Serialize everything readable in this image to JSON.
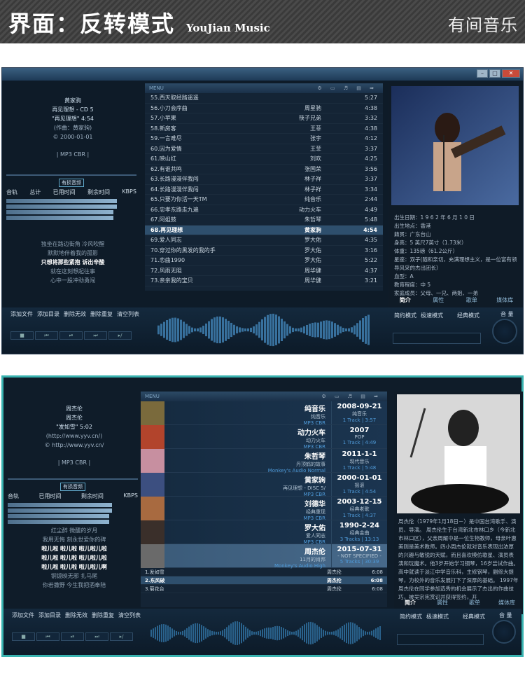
{
  "banner": {
    "title": "界面：反转模式",
    "subtitle": "YouJian Music",
    "brand": "有间音乐"
  },
  "window1": {
    "meta": {
      "artist": "黄家驹",
      "album": "再见理想 - CD 5",
      "track": "\"再见理想\" 4:54",
      "lyricist": "(作曲：黄家驹)",
      "copyright": "© 2000-01-01",
      "format": "| MP3 CBR |"
    },
    "vis": {
      "tabs": [
        "有损音频"
      ],
      "labels": [
        "音轨",
        "总计",
        "已用时间",
        "剩余时间",
        "KBPS"
      ],
      "bitrate": "128"
    },
    "lyrics": [
      "独坐在路边街角 冷风吹醒",
      "默默地伴着我的孤影",
      "只想将那些紧抱 诉出辛酸",
      "就在这刻想起往事",
      "",
      "心中一股冲劲勇闯"
    ],
    "list_label": "MENU",
    "list_icons": "⚙ ▭ ♬ ▤ ➡",
    "rows": [
      {
        "t": "55.西天取经路遥遥",
        "a": "",
        "d": "5:27"
      },
      {
        "t": "56.小刀会序曲",
        "a": "周星驰",
        "d": "4:38"
      },
      {
        "t": "57.小苹果",
        "a": "筷子兄弟",
        "d": "3:32"
      },
      {
        "t": "58.新房客",
        "a": "王菲",
        "d": "4:38"
      },
      {
        "t": "59.一言难尽",
        "a": "张宇",
        "d": "4:12"
      },
      {
        "t": "60.因为爱情",
        "a": "王菲",
        "d": "3:37"
      },
      {
        "t": "61.映山红",
        "a": "刘欢",
        "d": "4:25"
      },
      {
        "t": "62.有谁共鸣",
        "a": "张国荣",
        "d": "3:56"
      },
      {
        "t": "63.长路漫漫伴我闯",
        "a": "林子祥",
        "d": "3:37"
      },
      {
        "t": "64.长路漫漫伴我闯",
        "a": "林子祥",
        "d": "3:34"
      },
      {
        "t": "65.只要为你活一天TM",
        "a": "纯音乐",
        "d": "2:44"
      },
      {
        "t": "66.忠孝东路走九遍",
        "a": "动力火车",
        "d": "4:49"
      },
      {
        "t": "67.阿姐鼓",
        "a": "朱哲琴",
        "d": "5:48"
      },
      {
        "t": "68.再见理想",
        "a": "黄家驹",
        "d": "4:54",
        "sel": true
      },
      {
        "t": "69.爱人同志",
        "a": "罗大佑",
        "d": "4:35"
      },
      {
        "t": "70.穿过你的黑发的我的手",
        "a": "罗大佑",
        "d": "3:16"
      },
      {
        "t": "71.恋曲1990",
        "a": "罗大佑",
        "d": "5:22"
      },
      {
        "t": "72.风雨无阻",
        "a": "周华健",
        "d": "4:37"
      },
      {
        "t": "73.亲亲我的宝贝",
        "a": "周华健",
        "d": "3:21"
      }
    ],
    "bio": [
      "出生日期：1 9 6 2 年 6 月 1 0 日",
      "出生地点：香港",
      "籍贯：广东台山",
      "身高：5 英尺7英寸（1.73米）",
      "体重：135磅（61.2公斤）",
      "星座：双子(随和亲切，充满理想主义，是一位富有领导风采的杰出团长）",
      "血型：A",
      "教育程度：中 5",
      "家庭成员：父母、一兄、两姐、一弟"
    ],
    "right_tabs": [
      "简介",
      "属性",
      "歌单",
      "媒体库"
    ],
    "bottom_btns": [
      "添加文件",
      "添加目录",
      "删除无效",
      "删除重复",
      "清空列表"
    ],
    "ctrl_icons": [
      "■",
      "⏮",
      "⏯",
      "⏭",
      "▸/"
    ],
    "mode_btns": [
      "简约模式",
      "极速模式",
      "经典模式"
    ],
    "volume": "音 量"
  },
  "window2": {
    "meta": {
      "artist": "周杰伦",
      "album": "周杰伦",
      "track": "\"发如雪\" 5:02",
      "url1": "(http://www.yyv.cn/)",
      "url2": "© http://www.yyv.cn/",
      "format": "| MP3 CBR |"
    },
    "vis": {
      "tabs": [
        "有损音频"
      ],
      "labels": [
        "音轨",
        "已用时间",
        "剩余时间",
        "KBPS"
      ],
      "bitrate": "320"
    },
    "lyrics": [
      "红尘醉 微醺的岁月",
      "我用无悔 刻永世爱你的碑",
      "",
      "啦儿啦 啦儿啦 啦儿啦儿啦",
      "啦儿啦 啦儿啦 啦儿啦儿啦",
      "啦儿啦 啦儿啦 啦儿啦儿啊",
      "铜镜映无邪 扎马尾",
      "你若撒野 今生我把酒奉陪"
    ],
    "list_label": "MENU",
    "list_icons": "⚙ ▭ ♬ ▤ ➡",
    "albums": [
      {
        "a": "纯音乐",
        "b": "纯音乐",
        "c": "MP3 CBR",
        "d": "2008-09-21",
        "e": "纯音乐",
        "f": "1 Track | 3:57",
        "color": "#7a6a3c"
      },
      {
        "a": "动力火车",
        "b": "动力火车",
        "c": "MP3 CBR",
        "d": "2007",
        "e": "POP",
        "f": "1 Track | 4:49",
        "color": "#b2442c"
      },
      {
        "a": "朱哲琴",
        "b": "丹顶鹤的故事",
        "c": "Monkey's Audio Normal",
        "d": "2011-1-1",
        "e": "现代音乐",
        "f": "1 Track | 5:48",
        "color": "#c78fa0"
      },
      {
        "a": "黄家驹",
        "b": "再见理想 - DISC 5/",
        "c": "MP3 CBR",
        "d": "2000-01-01",
        "e": "摇滚",
        "f": "1 Track | 4:54",
        "color": "#3c4f80"
      },
      {
        "a": "刘德华",
        "b": "经典重现",
        "c": "MP3 CBR",
        "d": "2003-12-15",
        "e": "经典老歌",
        "f": "1 Track | 4:37",
        "color": "#a86a40"
      },
      {
        "a": "罗大佑",
        "b": "爱人同志",
        "c": "MP3 CBR",
        "d": "1990-2-24",
        "e": "经典金曲",
        "f": "3 Tracks | 13:13",
        "color": "#3a2f2a"
      },
      {
        "a": "周杰伦",
        "b": "11月的肖邦",
        "c": "Monkey's Audio High",
        "d": "2015-07-31",
        "e": "- NOT SPECIFIED -",
        "f": "5 Tracks | 30:39",
        "color": "#6a6a6a",
        "sel": true
      }
    ],
    "tracks": [
      {
        "t": "1.发如雪",
        "a": "周杰伦",
        "d": "6:08"
      },
      {
        "t": "2.东风破",
        "a": "周杰伦",
        "d": "6:08",
        "sel": true
      },
      {
        "t": "3.菊花台",
        "a": "周杰伦",
        "d": "6:08"
      }
    ],
    "bio": "周杰伦（1979年1月18日－）是中国台湾歌手、演员、导演。 周杰伦生于台湾新北市林口乡（今新北市林口区），父亲周耀中是一位生物教师，母亲叶惠美则是美术教师。四小周杰伦就对音乐表现出浓厚的兴趣与敏锐的天赋，而且喜欢模仿歌星、演员表演和玩魔术。他3岁开始学习钢琴，16岁尝试作曲。高中就读于淡江中学音乐科，主修钢琴，副修大提琴，为校外的音乐发展打下了深厚的基础。 1997年周杰伦在同学参加选秀的机会展示了杰出的作曲技巧，被吴宗宪赏识并获得签约，开",
    "right_tabs": [
      "简介",
      "属性",
      "歌单",
      "媒体库"
    ],
    "bottom_btns": [
      "添加文件",
      "添加目录",
      "删除无效",
      "删除重复",
      "清空列表"
    ],
    "ctrl_icons": [
      "■",
      "⏮",
      "⏯",
      "⏭",
      "▸/"
    ],
    "mode_btns": [
      "简约模式",
      "极速模式",
      "经典模式"
    ],
    "volume": "音 量"
  }
}
